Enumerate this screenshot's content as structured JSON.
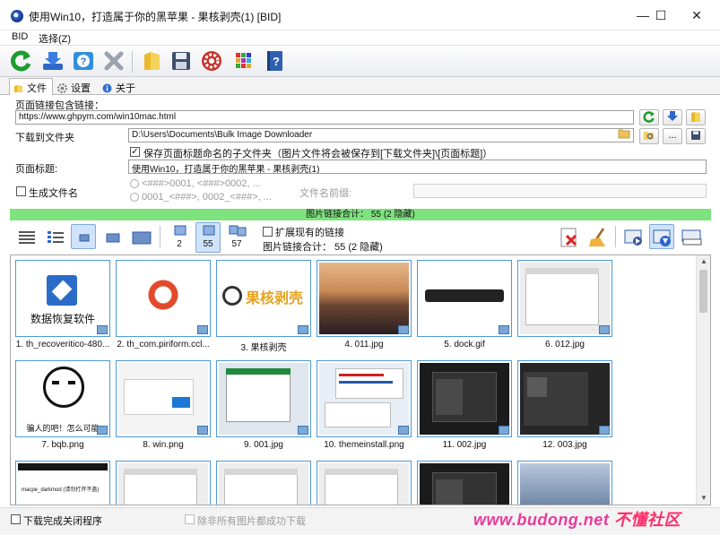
{
  "window": {
    "title": "使用Win10，打造属于你的黑苹果 - 果核剥壳(1) [BID]",
    "minimize": "—",
    "maximize": "☐",
    "close": "✕"
  },
  "menu": {
    "items": [
      "BID",
      "选择(Z)"
    ]
  },
  "toolbar": {
    "buttons": [
      "refresh-icon",
      "download-icon",
      "help-icon",
      "delete-icon",
      "folder-icon",
      "save-icon",
      "settings-gear-icon",
      "grid-icon",
      "book-help-icon"
    ]
  },
  "tabs": [
    {
      "label": "文件",
      "icon": "folder-icon",
      "active": true
    },
    {
      "label": "设置",
      "icon": "gear-icon",
      "active": false
    },
    {
      "label": "关于",
      "icon": "info-icon",
      "active": false
    }
  ],
  "form": {
    "url_label": "页面链接包含链接：",
    "url_value": "https://www.ghpym.com/win10mac.html",
    "download_to_label": "下载到文件夹",
    "download_path": "D:\\Users\\Documents\\Bulk Image Downloader",
    "save_subfolder_checked": true,
    "save_subfolder_label": "保存页面标题命名的子文件夹（图片文件将会被保存到[下载文件夹]\\[页面标题]）",
    "page_title_label": "页面标题:",
    "page_title_value": "使用Win10，打造属于你的黑苹果 - 果核剥壳(1)",
    "generate_filename_label": "生成文件名",
    "generate_filename_checked": false,
    "pattern_1": "<###>0001, <###>0002, ...",
    "pattern_2": "0001_<###>, 0002_<###>, ...",
    "prefix_label": "文件名前缀:",
    "prefix_value": "",
    "browse_label": "..."
  },
  "summary": {
    "green_text": "图片链接合计：  55 (2 隐藏)",
    "expand_label": "扩展现有的链接",
    "expand_checked": false,
    "count_text": "图片链接合计：  55 (2 隐藏)"
  },
  "view": {
    "counts": [
      "2",
      "55",
      "57"
    ]
  },
  "gallery": {
    "items": [
      {
        "caption": "1. th_recoveritico-480...",
        "kind": "recover",
        "text": "数据恢复软件",
        "accent": "#2b6cc9"
      },
      {
        "caption": "2. th_com.piriform.ccl...",
        "kind": "ccleaner",
        "accent": "#e14a2b"
      },
      {
        "caption": "3. 果核剥壳",
        "kind": "logo",
        "text": "果核剥壳",
        "accent": "#e6a21c"
      },
      {
        "caption": "4. 011.jpg",
        "kind": "desert",
        "accent": "#c98a56"
      },
      {
        "caption": "5. dock.gif",
        "kind": "dock",
        "accent": "#222222"
      },
      {
        "caption": "6. 012.jpg",
        "kind": "window",
        "accent": "#ececec"
      },
      {
        "caption": "7. bqb.png",
        "kind": "meme",
        "text": "骗人的吧！怎么可能",
        "accent": "#111111"
      },
      {
        "caption": "8. win.png",
        "kind": "winlogo",
        "accent": "#1b78d4"
      },
      {
        "caption": "9. 001.jpg",
        "kind": "dialog",
        "accent": "#1f8a3a"
      },
      {
        "caption": "10. themeinstall.png",
        "kind": "install",
        "accent": "#cc2222"
      },
      {
        "caption": "11. 002.jpg",
        "kind": "dark",
        "accent": "#1b1b1b"
      },
      {
        "caption": "12. 003.jpg",
        "kind": "dark2",
        "accent": "#262626"
      },
      {
        "caption": "",
        "kind": "terminal",
        "text": "macpe_darkmod (请勿打开不盖)",
        "accent": "#151515"
      },
      {
        "caption": "",
        "kind": "window",
        "accent": "#ededed"
      },
      {
        "caption": "",
        "kind": "window",
        "accent": "#ededed"
      },
      {
        "caption": "",
        "kind": "window",
        "accent": "#ededed"
      },
      {
        "caption": "",
        "kind": "dark",
        "accent": "#1b1b1b"
      },
      {
        "caption": "",
        "kind": "sierra",
        "accent": "#6f86a6"
      }
    ]
  },
  "status": {
    "close_after_label": "下载完成关闭程序",
    "close_after_checked": false,
    "unless_failed_label": "除非所有图片都成功下载"
  },
  "watermark": {
    "url": "www.budong.net",
    "cn": "不懂社区"
  }
}
